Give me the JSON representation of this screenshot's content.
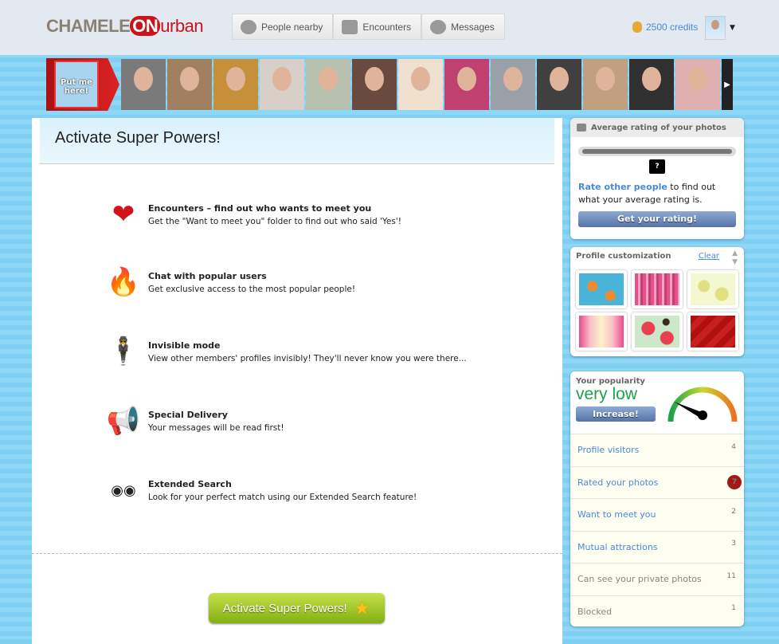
{
  "header": {
    "logo": {
      "pre": "CHAMELE",
      "on": "ON",
      "post": "urban"
    },
    "nav": [
      {
        "label": "People nearby",
        "icon": "people-icon"
      },
      {
        "label": "Encounters",
        "icon": "dice-icon"
      },
      {
        "label": "Messages",
        "icon": "chat-bubble-icon"
      }
    ],
    "credits": "2500 credits"
  },
  "strip": {
    "me_label": "Put me here!",
    "photo_colors": [
      "#7a7a7a",
      "#a08060",
      "#c6903a",
      "#d8d0c8",
      "#b8c0b0",
      "#6a4a40",
      "#f0e0d0",
      "#c04070",
      "#9aa0a8",
      "#404040",
      "#c0a080",
      "#303030",
      "#e0b0b0"
    ]
  },
  "main": {
    "title": "Activate Super Powers!",
    "features": [
      {
        "title": "Encounters – find out who wants to meet you",
        "desc": "Get the \"Want to meet you\" folder to find out who said 'Yes'!",
        "icon": "heart-icon"
      },
      {
        "title": "Chat with popular users",
        "desc": "Get exclusive access to the most popular people!",
        "icon": "flame-icon"
      },
      {
        "title": "Invisible mode",
        "desc": "View other members' profiles invisibly! They'll never know you were there...",
        "icon": "spy-icon"
      },
      {
        "title": "Special Delivery",
        "desc": "Your messages will be read first!",
        "icon": "megaphone-icon"
      },
      {
        "title": "Extended Search",
        "desc": "Look for your perfect match using our Extended Search feature!",
        "icon": "binoculars-icon"
      }
    ],
    "cta": "Activate Super Powers!"
  },
  "rating": {
    "title": "Average rating of your photos",
    "value": "?",
    "link": "Rate other people",
    "text": " to find out what your average rating is.",
    "button": "Get your rating!"
  },
  "custom": {
    "title": "Profile customization",
    "clear": "Clear"
  },
  "popularity": {
    "title": "Your popularity",
    "level": "very low",
    "button": "Increase!",
    "stats": [
      {
        "label": "Profile visitors",
        "count": "4"
      },
      {
        "label": "Rated your photos",
        "count": "7",
        "badge": true
      },
      {
        "label": "Want to meet you",
        "count": "2"
      },
      {
        "label": "Mutual attractions",
        "count": "3"
      },
      {
        "label": "Can see your private photos",
        "count": "11",
        "muted": true
      },
      {
        "label": "Blocked",
        "count": "1",
        "muted": true
      }
    ]
  }
}
